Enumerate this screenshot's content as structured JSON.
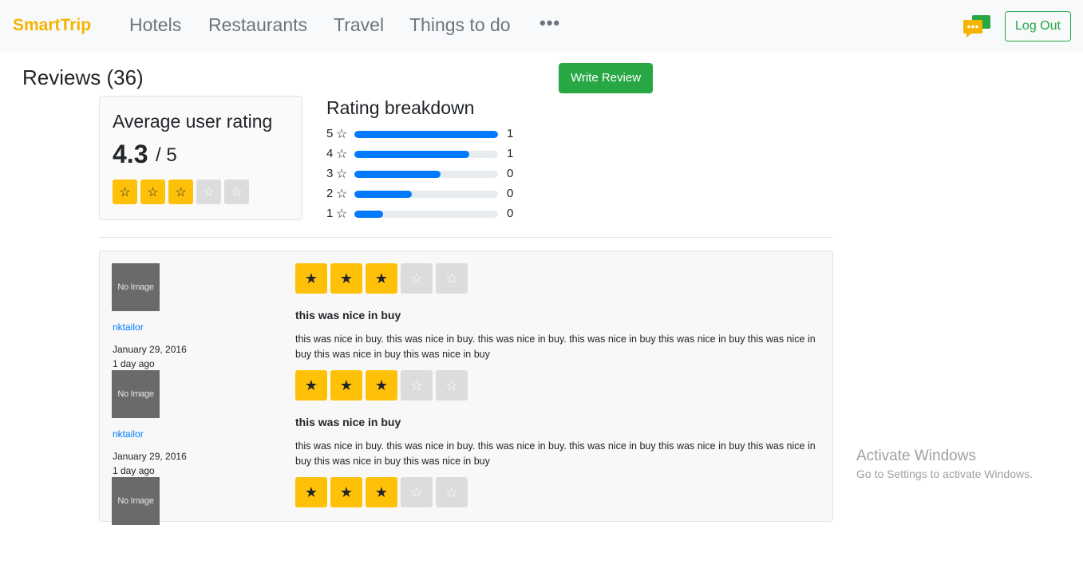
{
  "nav": {
    "brand": "SmartTrip",
    "links": [
      "Hotels",
      "Restaurants",
      "Travel",
      "Things to do"
    ],
    "more": "•••",
    "logout": "Log Out"
  },
  "reviews_header": {
    "title": "Reviews (36)",
    "write_button": "Write Review"
  },
  "average": {
    "title": "Average user rating",
    "value": "4.3",
    "max": "/ 5",
    "stars_filled": 3,
    "stars_total": 5
  },
  "breakdown": {
    "title": "Rating breakdown",
    "rows": [
      {
        "stars": "5",
        "fill_percent": 100,
        "count": "1"
      },
      {
        "stars": "4",
        "fill_percent": 80,
        "count": "1"
      },
      {
        "stars": "3",
        "fill_percent": 60,
        "count": "0"
      },
      {
        "stars": "2",
        "fill_percent": 40,
        "count": "0"
      },
      {
        "stars": "1",
        "fill_percent": 20,
        "count": "0"
      }
    ]
  },
  "reviews": [
    {
      "image_text": "No Image",
      "user": "nktailor",
      "date": "January 29, 2016",
      "ago": "1 day ago",
      "rating": 3,
      "title": "this was nice in buy",
      "body": "this was nice in buy. this was nice in buy. this was nice in buy. this was nice in buy this was nice in buy this was nice in buy this was nice in buy this was nice in buy"
    },
    {
      "image_text": "No Image",
      "user": "nktailor",
      "date": "January 29, 2016",
      "ago": "1 day ago",
      "rating": 3,
      "title": "this was nice in buy",
      "body": "this was nice in buy. this was nice in buy. this was nice in buy. this was nice in buy this was nice in buy this was nice in buy this was nice in buy this was nice in buy"
    },
    {
      "image_text": "No Image",
      "user": "",
      "date": "",
      "ago": "",
      "rating": 3,
      "title": "",
      "body": ""
    }
  ],
  "colors": {
    "brand": "#f4b400",
    "accent": "#28a745",
    "bar": "#007bff",
    "star_on": "#ffc107",
    "star_off": "#dcdcdc"
  },
  "watermark": {
    "line1": "Activate Windows",
    "line2": "Go to Settings to activate Windows."
  }
}
